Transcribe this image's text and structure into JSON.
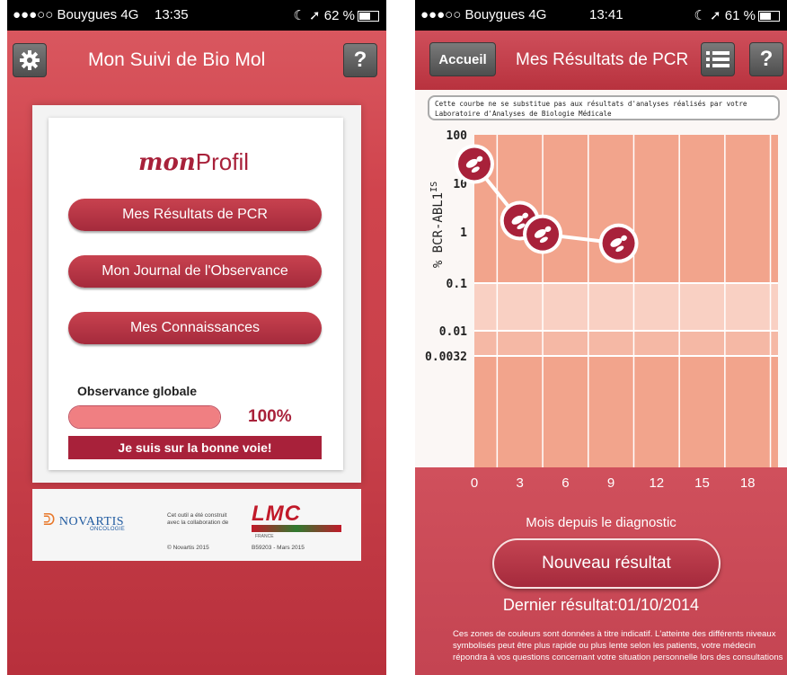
{
  "left_phone": {
    "status": {
      "carrier": "●●●○○ Bouygues",
      "network": "4G",
      "time": "13:35",
      "battery": "62 %",
      "battery_level": 0.62
    },
    "header": {
      "title": "Mon Suivi de Bio Mol",
      "settings_icon": "gear-icon",
      "help_label": "?"
    },
    "card": {
      "logo_mon": "mon",
      "logo_profil": "Profil",
      "menu": [
        {
          "label": "Mes Résultats de PCR"
        },
        {
          "label": "Mon Journal de l'Observance"
        },
        {
          "label": "Mes Connaissances"
        }
      ],
      "observance_label": "Observance globale",
      "observance_value": "100%",
      "observance_level": 1.0,
      "banner": "Je suis sur la bonne voie!"
    },
    "footer": {
      "novartis": "NOVARTIS",
      "novartis_sub": "ONCOLOGIE",
      "collab_line1": "Cet outil a été construit",
      "collab_line2": "avec la collaboration de",
      "copyright": "© Novartis 2015",
      "lmc": "LMC",
      "lmc_sub": "FRANCE",
      "reference": "B59203 - Mars 2015"
    }
  },
  "right_phone": {
    "status": {
      "carrier": "●●●○○ Bouygues",
      "network": "4G",
      "time": "13:41",
      "battery": "61 %",
      "battery_level": 0.61
    },
    "header": {
      "accueil_label": "Accueil",
      "title": "Mes Résultats de PCR",
      "list_icon": "list-icon",
      "help_label": "?"
    },
    "disclaimer": "Cette courbe ne se substitue pas aux résultats d'analyses réalisés par votre Laboratoire d'Analyses de Biologie Médicale",
    "action_button": "Nouveau résultat",
    "last_result": "Dernier résultat:01/10/2014",
    "note": "Ces zones de couleurs sont données à titre indicatif. L'atteinte des différents niveaux symbolisés peut être plus rapide ou plus lente selon les patients, votre médecin répondra à vos questions concernant votre situation personnelle lors des consultations"
  },
  "chart_data": {
    "type": "line",
    "title": "",
    "xlabel": "Mois depuis le diagnostic",
    "ylabel": "% BCR-ABL1IS",
    "ylabel_main": "% BCR-ABL1",
    "ylabel_sup": "IS",
    "y_scale": "log",
    "x_ticks": [
      "0",
      "3",
      "6",
      "9",
      "12",
      "15",
      "18"
    ],
    "y_ticks": [
      "100",
      "10",
      "1",
      "0.1",
      "0.01",
      "0.0032"
    ],
    "xlim": [
      0,
      20
    ],
    "marker_icon": "footprint-icon",
    "zones": [
      {
        "from": 0.1,
        "to": 100,
        "color": "#f2a48c"
      },
      {
        "from": 0.01,
        "to": 0.1,
        "color": "#f9d0c3"
      },
      {
        "from": 0.0032,
        "to": 0.01,
        "color": "#f5b8a5"
      },
      {
        "from": 0.0001,
        "to": 0.0032,
        "color": "#f2a48c"
      }
    ],
    "series": [
      {
        "x": [
          0,
          3,
          4.5,
          9.5
        ],
        "y": [
          25,
          1.7,
          0.9,
          0.6
        ]
      }
    ]
  }
}
